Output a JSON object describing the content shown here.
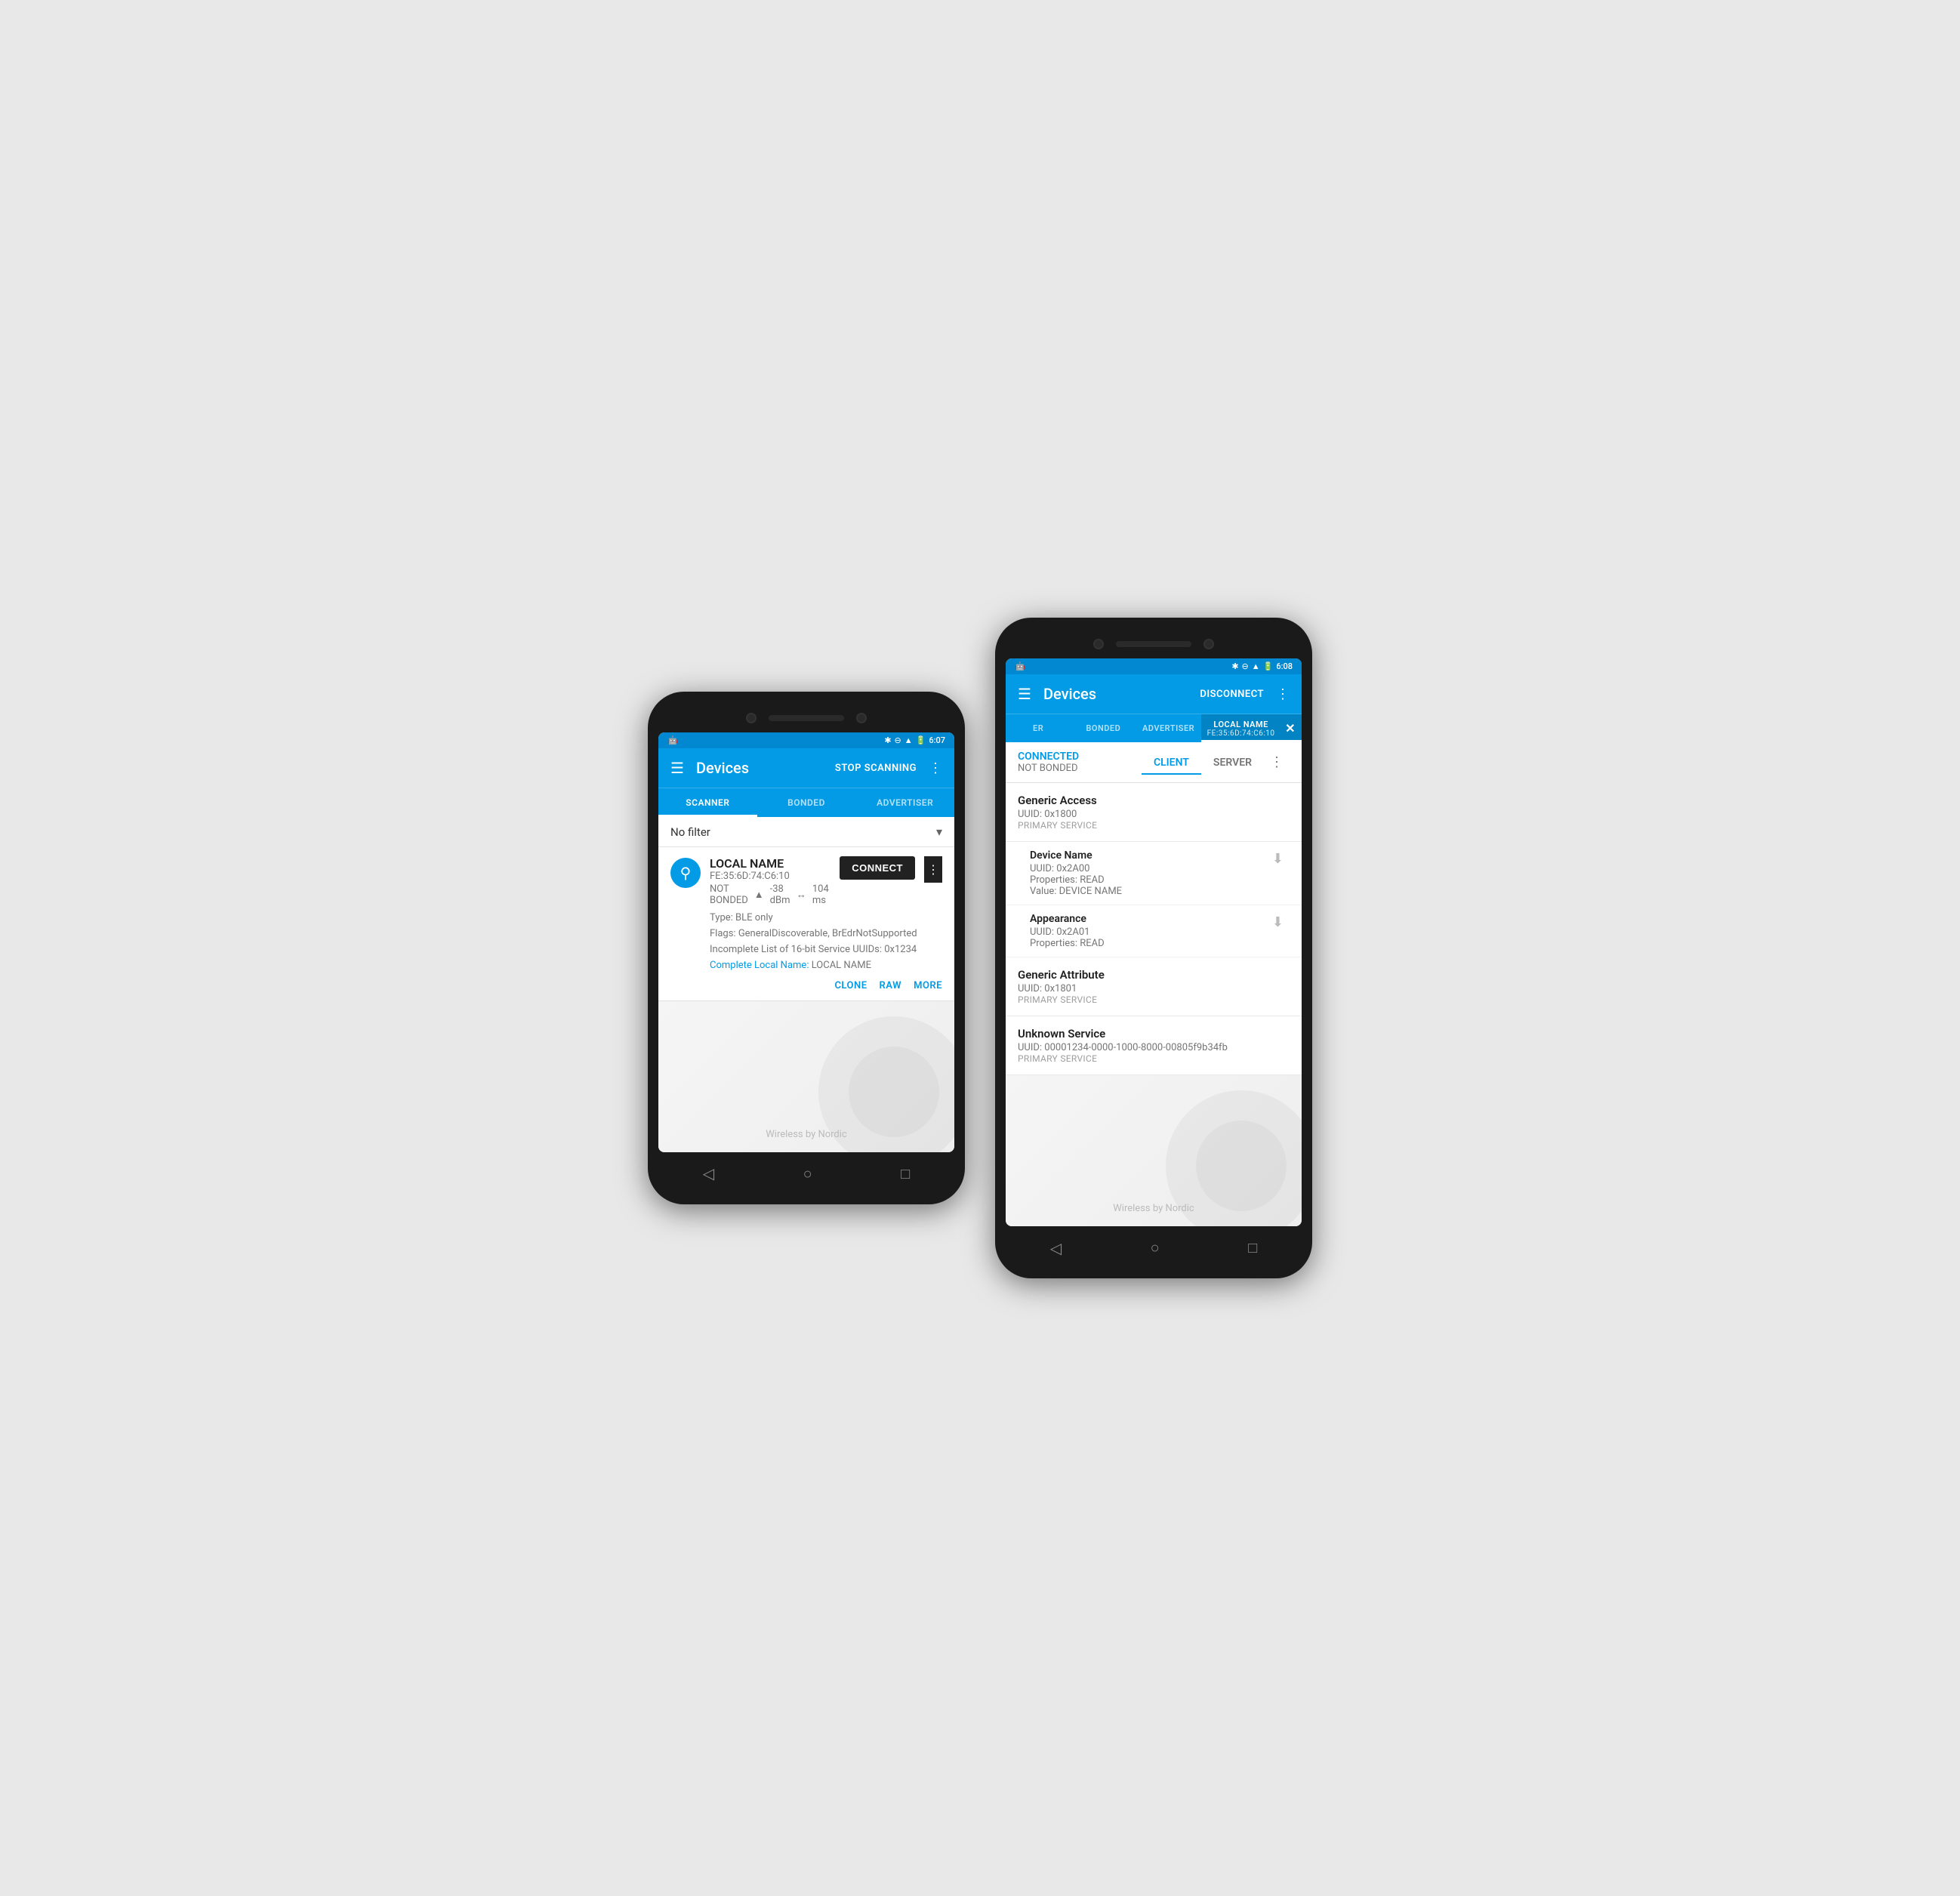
{
  "phone1": {
    "statusBar": {
      "time": "6:07",
      "icons": "bluetooth signal wifi battery"
    },
    "appBar": {
      "title": "Devices",
      "action": "STOP SCANNING"
    },
    "tabs": [
      {
        "label": "SCANNER",
        "active": true
      },
      {
        "label": "BONDED",
        "active": false
      },
      {
        "label": "ADVERTISER",
        "active": false
      }
    ],
    "filter": {
      "text": "No filter"
    },
    "device": {
      "name": "LOCAL NAME",
      "mac": "FE:35:6D:74:C6:10",
      "bondStatus": "NOT BONDED",
      "rssi": "-38 dBm",
      "interval": "104 ms",
      "type": "BLE only",
      "flags": "GeneralDiscoverable, BrEdrNotSupported",
      "serviceUUIDs": "Incomplete List of 16-bit Service UUIDs: 0x1234",
      "completeName": "Complete Local Name:",
      "completeNameValue": "LOCAL NAME",
      "connectBtn": "CONNECT",
      "actions": {
        "clone": "CLONE",
        "raw": "RAW",
        "more": "MORE"
      }
    },
    "watermark": "Wireless by Nordic",
    "navIcons": [
      "◁",
      "○",
      "□"
    ]
  },
  "phone2": {
    "statusBar": {
      "time": "6:08",
      "icons": "bluetooth signal wifi battery"
    },
    "appBar": {
      "title": "Devices",
      "action": "DISCONNECT"
    },
    "tabs": [
      {
        "label": "ER",
        "active": false
      },
      {
        "label": "BONDED",
        "active": false
      },
      {
        "label": "ADVERTISER",
        "active": false
      },
      {
        "label": "LOCAL NAME",
        "sublabel": "FE:35:6D:74:C6:10",
        "active": true,
        "closeable": true
      }
    ],
    "connectionStatus": {
      "connected": "CONNECTED",
      "bonded": "NOT BONDED"
    },
    "clientServerTabs": [
      {
        "label": "CLIENT",
        "active": true
      },
      {
        "label": "SERVER",
        "active": false
      }
    ],
    "services": [
      {
        "name": "Generic Access",
        "uuid": "UUID: 0x1800",
        "type": "PRIMARY SERVICE",
        "characteristics": [
          {
            "name": "Device Name",
            "uuid": "UUID: 0x2A00",
            "properties": "Properties: READ",
            "value": "Value: DEVICE NAME",
            "hasDownload": true
          },
          {
            "name": "Appearance",
            "uuid": "UUID: 0x2A01",
            "properties": "Properties: READ",
            "value": "",
            "hasDownload": true
          }
        ]
      },
      {
        "name": "Generic Attribute",
        "uuid": "UUID: 0x1801",
        "type": "PRIMARY SERVICE",
        "characteristics": []
      },
      {
        "name": "Unknown Service",
        "uuid": "UUID: 00001234-0000-1000-8000-00805f9b34fb",
        "type": "PRIMARY SERVICE",
        "characteristics": []
      }
    ],
    "watermark": "Wireless by Nordic",
    "navIcons": [
      "◁",
      "○",
      "□"
    ]
  }
}
